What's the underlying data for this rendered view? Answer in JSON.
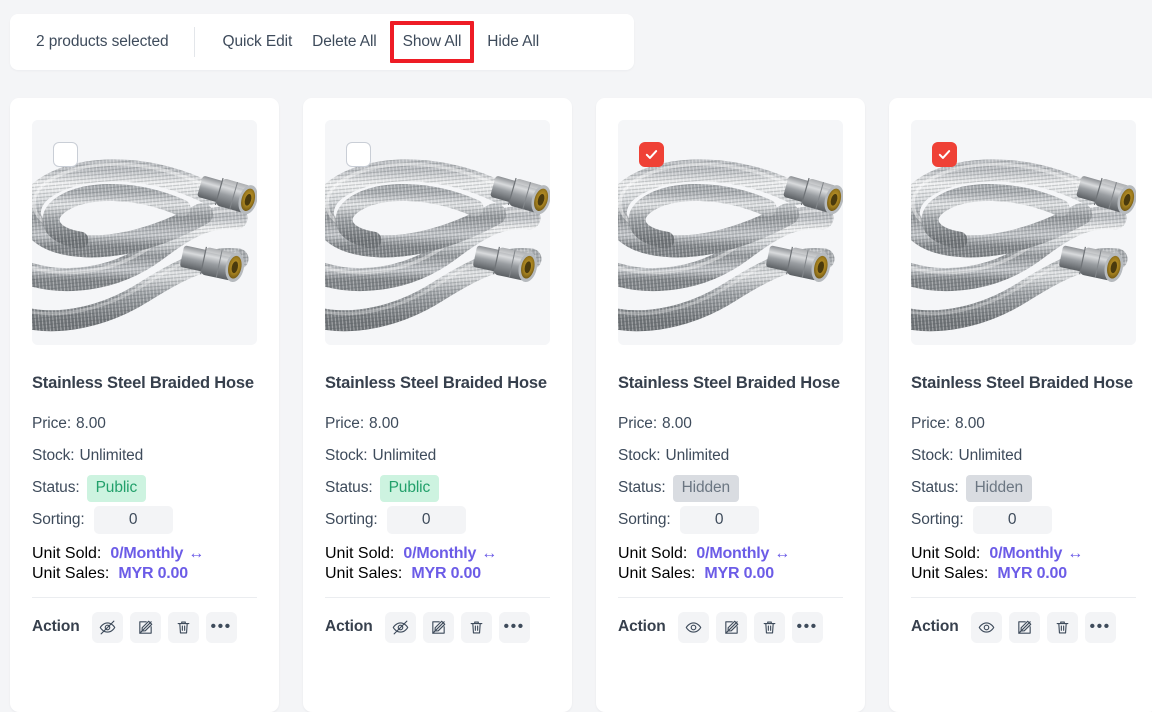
{
  "toolbar": {
    "selection_text": "2 products selected",
    "buttons": [
      {
        "label": "Quick Edit",
        "name": "quick-edit-button",
        "highlighted": false
      },
      {
        "label": "Delete All",
        "name": "delete-all-button",
        "highlighted": false
      },
      {
        "label": "Show All",
        "name": "show-all-button",
        "highlighted": true
      },
      {
        "label": "Hide All",
        "name": "hide-all-button",
        "highlighted": false
      }
    ],
    "highlight_color": "#ee1c25"
  },
  "labels": {
    "price": "Price:",
    "stock": "Stock:",
    "status": "Status:",
    "sorting": "Sorting:",
    "unit_sold": "Unit Sold:",
    "unit_sales": "Unit Sales:",
    "action": "Action"
  },
  "colors": {
    "accent_purple": "#6c5ce7",
    "badge_public_bg": "#cdf3e0",
    "badge_public_fg": "#22a06b",
    "badge_hidden_bg": "#d9dce1",
    "badge_hidden_fg": "#6b7682",
    "checkbox_checked": "#ef4136",
    "page_bg": "#f4f5f7"
  },
  "products": [
    {
      "title": "Stainless Steel Braided Hose",
      "price": "8.00",
      "stock": "Unlimited",
      "status": "Public",
      "status_kind": "public",
      "sorting": "0",
      "unit_sold": "0/Monthly",
      "unit_sales": "MYR 0.00",
      "selected": false,
      "visibility_icon": "eye-off-icon"
    },
    {
      "title": "Stainless Steel Braided Hose",
      "price": "8.00",
      "stock": "Unlimited",
      "status": "Public",
      "status_kind": "public",
      "sorting": "0",
      "unit_sold": "0/Monthly",
      "unit_sales": "MYR 0.00",
      "selected": false,
      "visibility_icon": "eye-off-icon"
    },
    {
      "title": "Stainless Steel Braided Hose",
      "price": "8.00",
      "stock": "Unlimited",
      "status": "Hidden",
      "status_kind": "hidden",
      "sorting": "0",
      "unit_sold": "0/Monthly",
      "unit_sales": "MYR 0.00",
      "selected": true,
      "visibility_icon": "eye-icon"
    },
    {
      "title": "Stainless Steel Braided Hose",
      "price": "8.00",
      "stock": "Unlimited",
      "status": "Hidden",
      "status_kind": "hidden",
      "sorting": "0",
      "unit_sold": "0/Monthly",
      "unit_sales": "MYR 0.00",
      "selected": true,
      "visibility_icon": "eye-icon"
    }
  ]
}
